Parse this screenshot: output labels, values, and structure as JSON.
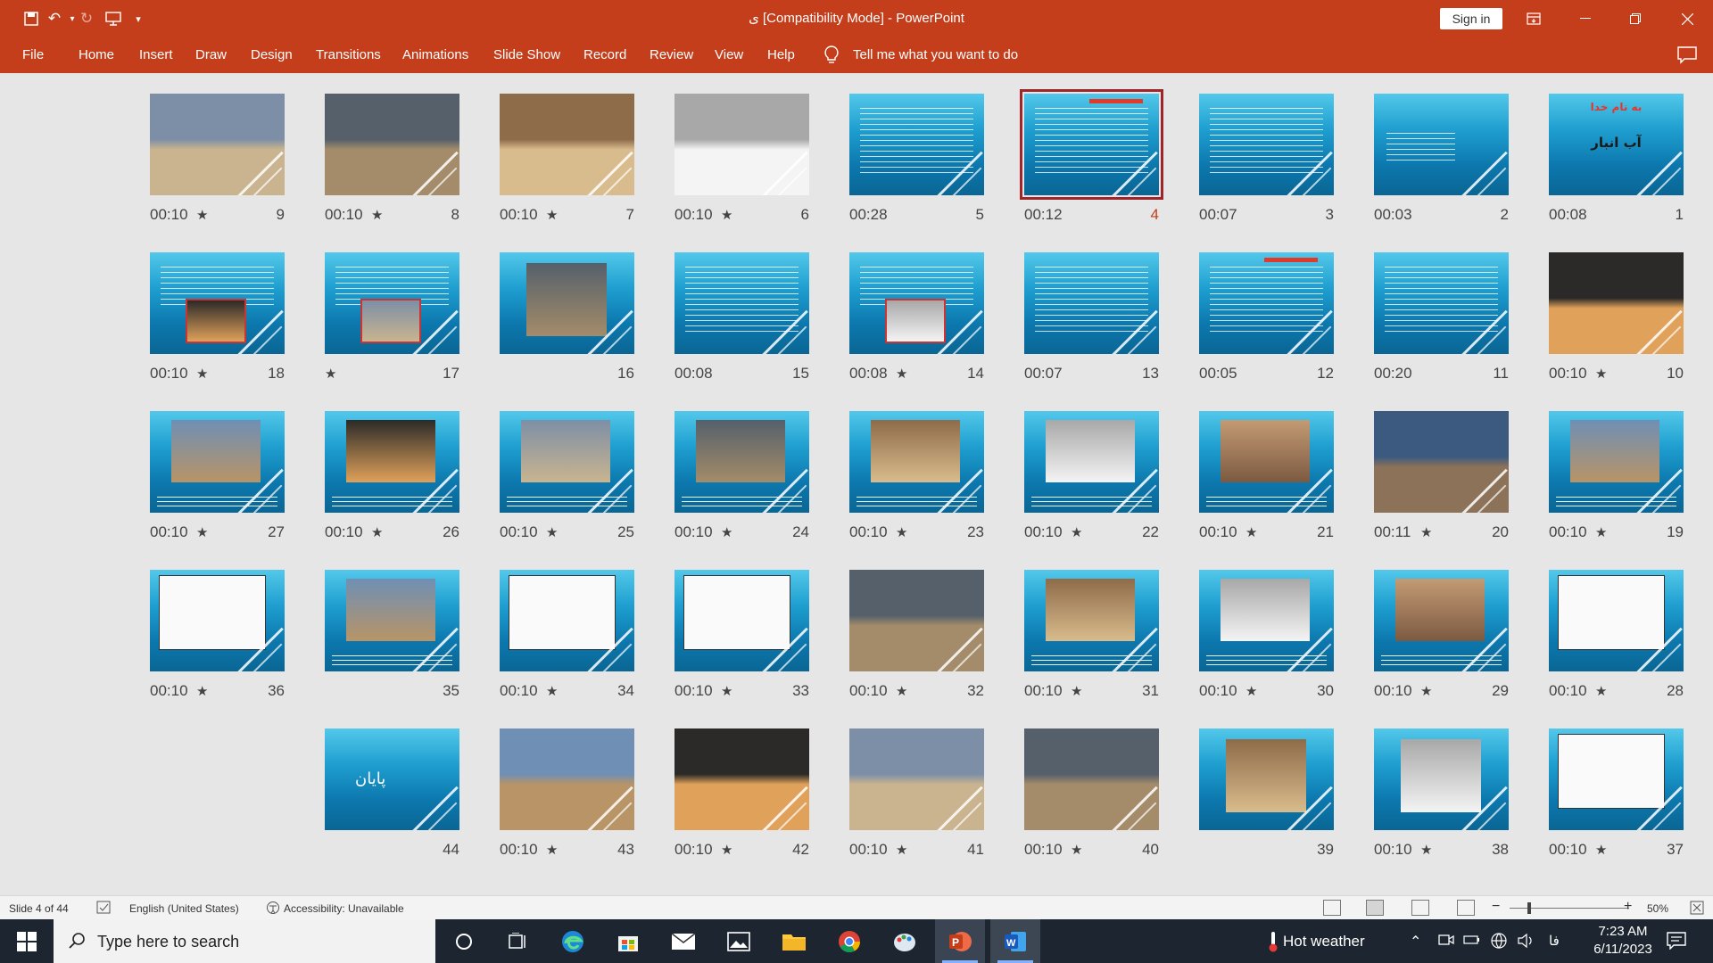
{
  "window": {
    "title": "ی [Compatibility Mode]  -  PowerPoint",
    "sign_in": "Sign in"
  },
  "ribbon": {
    "tabs": [
      "File",
      "Home",
      "Insert",
      "Draw",
      "Design",
      "Transitions",
      "Animations",
      "Slide Show",
      "Record",
      "Review",
      "View",
      "Help"
    ],
    "tell_me": "Tell me what you want to do"
  },
  "slides": [
    {
      "number": "1",
      "time": "00:08",
      "star": false,
      "kind": "title"
    },
    {
      "number": "2",
      "time": "00:03",
      "star": false,
      "kind": "toc"
    },
    {
      "number": "3",
      "time": "00:07",
      "star": false,
      "kind": "text"
    },
    {
      "number": "4",
      "time": "00:12",
      "star": false,
      "kind": "text-red",
      "selected": true
    },
    {
      "number": "5",
      "time": "00:28",
      "star": false,
      "kind": "text"
    },
    {
      "number": "6",
      "time": "00:10",
      "star": true,
      "kind": "photo"
    },
    {
      "number": "7",
      "time": "00:10",
      "star": true,
      "kind": "photo"
    },
    {
      "number": "8",
      "time": "00:10",
      "star": true,
      "kind": "photo"
    },
    {
      "number": "9",
      "time": "00:10",
      "star": true,
      "kind": "photo"
    },
    {
      "number": "10",
      "time": "00:10",
      "star": true,
      "kind": "photo"
    },
    {
      "number": "11",
      "time": "00:20",
      "star": false,
      "kind": "text"
    },
    {
      "number": "12",
      "time": "00:05",
      "star": false,
      "kind": "text-red"
    },
    {
      "number": "13",
      "time": "00:07",
      "star": false,
      "kind": "text"
    },
    {
      "number": "14",
      "time": "00:08",
      "star": true,
      "kind": "text-photo"
    },
    {
      "number": "15",
      "time": "00:08",
      "star": false,
      "kind": "text"
    },
    {
      "number": "16",
      "time": "",
      "star": false,
      "kind": "photo-center"
    },
    {
      "number": "17",
      "time": "",
      "star": true,
      "kind": "text-photo"
    },
    {
      "number": "18",
      "time": "00:10",
      "star": true,
      "kind": "text-photo"
    },
    {
      "number": "19",
      "time": "00:10",
      "star": true,
      "kind": "photo-caption"
    },
    {
      "number": "20",
      "time": "00:11",
      "star": true,
      "kind": "photo"
    },
    {
      "number": "21",
      "time": "00:10",
      "star": true,
      "kind": "photo-caption"
    },
    {
      "number": "22",
      "time": "00:10",
      "star": true,
      "kind": "photo-caption"
    },
    {
      "number": "23",
      "time": "00:10",
      "star": true,
      "kind": "photo-caption"
    },
    {
      "number": "24",
      "time": "00:10",
      "star": true,
      "kind": "photo-caption"
    },
    {
      "number": "25",
      "time": "00:10",
      "star": true,
      "kind": "photo-caption"
    },
    {
      "number": "26",
      "time": "00:10",
      "star": true,
      "kind": "photo-caption"
    },
    {
      "number": "27",
      "time": "00:10",
      "star": true,
      "kind": "photo-caption"
    },
    {
      "number": "28",
      "time": "00:10",
      "star": true,
      "kind": "diagram"
    },
    {
      "number": "29",
      "time": "00:10",
      "star": true,
      "kind": "photo-caption"
    },
    {
      "number": "30",
      "time": "00:10",
      "star": true,
      "kind": "photo-caption"
    },
    {
      "number": "31",
      "time": "00:10",
      "star": true,
      "kind": "photo-caption"
    },
    {
      "number": "32",
      "time": "00:10",
      "star": true,
      "kind": "photo"
    },
    {
      "number": "33",
      "time": "00:10",
      "star": true,
      "kind": "diagram"
    },
    {
      "number": "34",
      "time": "00:10",
      "star": true,
      "kind": "diagram"
    },
    {
      "number": "35",
      "time": "",
      "star": false,
      "kind": "photo-caption"
    },
    {
      "number": "36",
      "time": "00:10",
      "star": true,
      "kind": "diagram"
    },
    {
      "number": "37",
      "time": "00:10",
      "star": true,
      "kind": "diagram"
    },
    {
      "number": "38",
      "time": "00:10",
      "star": true,
      "kind": "photo-center"
    },
    {
      "number": "39",
      "time": "",
      "star": false,
      "kind": "photo-center"
    },
    {
      "number": "40",
      "time": "00:10",
      "star": true,
      "kind": "photo"
    },
    {
      "number": "41",
      "time": "00:10",
      "star": true,
      "kind": "photo"
    },
    {
      "number": "42",
      "time": "00:10",
      "star": true,
      "kind": "photo"
    },
    {
      "number": "43",
      "time": "00:10",
      "star": true,
      "kind": "photo"
    },
    {
      "number": "44",
      "time": "",
      "star": false,
      "kind": "end"
    }
  ],
  "slide_titles": {
    "1a": "به نام خدا",
    "1b": "آب انبار",
    "44": "پایان"
  },
  "status": {
    "slide_of": "Slide 4 of 44",
    "language": "English (United States)",
    "accessibility": "Accessibility: Unavailable",
    "zoom": "50%"
  },
  "taskbar": {
    "search_placeholder": "Type here to search",
    "weather": "Hot weather",
    "ime": "فا",
    "time": "7:23 AM",
    "date": "6/11/2023"
  },
  "colors": {
    "accent": "#c43e1c",
    "selection": "#a0252b",
    "slide_bg": "#1f9fd0"
  }
}
